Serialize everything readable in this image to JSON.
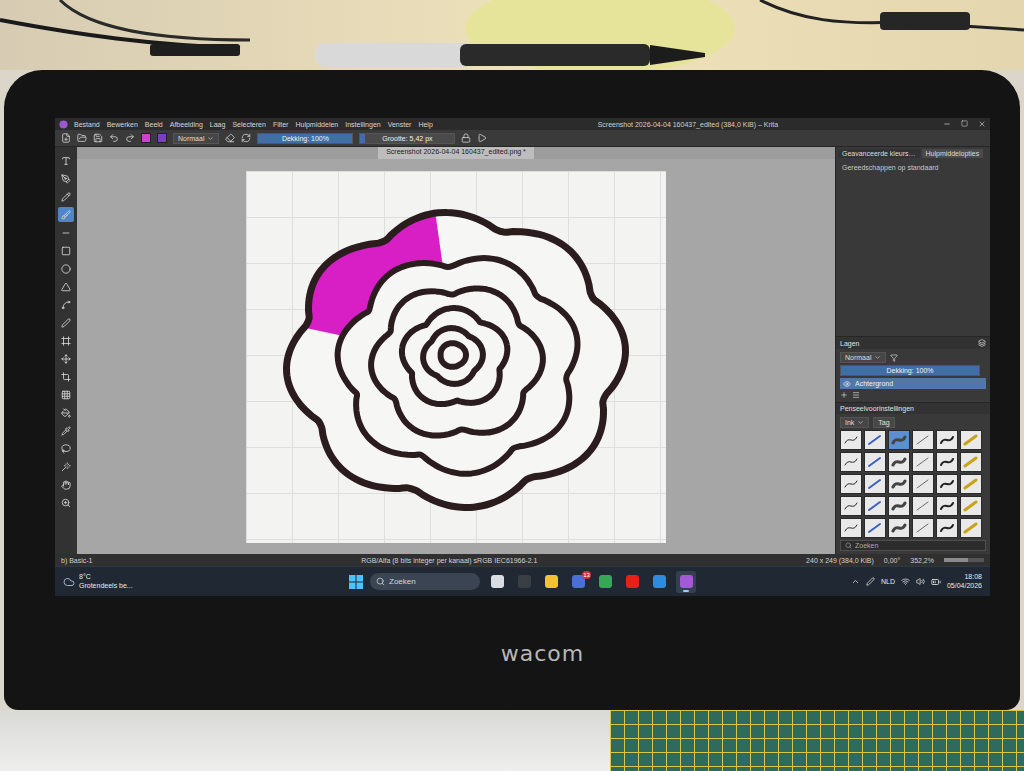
{
  "device": {
    "brand": "wacom"
  },
  "window": {
    "title": "Screenshot 2026-04-04 160437_edited (384,0 KiB) – Krita",
    "menu": [
      "Bestand",
      "Bewerken",
      "Beeld",
      "Afbeelding",
      "Laag",
      "Selecteren",
      "Filter",
      "Hulpmiddelen",
      "Instellingen",
      "Venster",
      "Help"
    ]
  },
  "toolbar": {
    "colors": [
      {
        "color": "#d43fc9"
      },
      {
        "color": "#7a3fc9"
      }
    ],
    "blend_mode": "Normaal",
    "opacity": "Dekking: 100%",
    "opacity_level": 1,
    "size": "Grootte: 5,42 px",
    "size_level": 0.05
  },
  "document_tab": {
    "label": "Screenshot 2026-04-04 160437_edited.png *",
    "selected": true
  },
  "tools": [
    {
      "selected": false
    },
    {
      "selected": false
    },
    {
      "selected": false
    },
    {
      "selected": true
    },
    {
      "selected": false
    },
    {
      "selected": false
    },
    {
      "selected": false
    },
    {
      "selected": false
    },
    {
      "selected": false
    },
    {
      "selected": false
    },
    {
      "selected": false
    },
    {
      "selected": false
    },
    {
      "selected": false
    },
    {
      "selected": false
    },
    {
      "selected": false
    },
    {
      "selected": false
    },
    {
      "selected": false
    },
    {
      "selected": false
    },
    {
      "selected": false
    },
    {
      "selected": false
    }
  ],
  "dock": {
    "tabs": [
      {
        "label": "Geavanceerde kleurs…",
        "selected": false
      },
      {
        "label": "Hulpmiddelopties",
        "selected": true
      }
    ],
    "hint": "Gereedschappen op standaard",
    "layers": {
      "title": "Lagen",
      "blend_mode": "Normaal",
      "opacity": "Dekking: 100%",
      "opacity_level": 1,
      "items": [
        {
          "name": "Achtergrond",
          "selected": true,
          "visible": true
        }
      ]
    },
    "brush_presets": {
      "title": "Penseelvoorinstellingen",
      "tag": "Ink",
      "tag_button": "Tag",
      "search": "Zoeken",
      "items": [
        {
          "selected": false
        },
        {
          "selected": false
        },
        {
          "selected": true
        },
        {
          "selected": false
        },
        {
          "selected": false
        },
        {
          "selected": false
        },
        {
          "selected": false
        },
        {
          "selected": false
        },
        {
          "selected": false
        },
        {
          "selected": false
        },
        {
          "selected": false
        },
        {
          "selected": false
        },
        {
          "selected": false
        },
        {
          "selected": false
        },
        {
          "selected": false
        },
        {
          "selected": false
        },
        {
          "selected": false
        },
        {
          "selected": false
        },
        {
          "selected": false
        },
        {
          "selected": false
        },
        {
          "selected": false
        },
        {
          "selected": false
        },
        {
          "selected": false
        },
        {
          "selected": false
        },
        {
          "selected": false
        },
        {
          "selected": false
        },
        {
          "selected": false
        },
        {
          "selected": false
        },
        {
          "selected": false
        },
        {
          "selected": false
        }
      ]
    }
  },
  "status_bar": {
    "preset": "b) Basic-1",
    "color_space": "RGB/Alfa (8 bits integer per kanaal)  sRGB IEC61966-2.1",
    "image_size": "240 x 249 (384,0 KiB)",
    "rotation": "0,00°",
    "zoom": "352,2%",
    "zoom_level": 0.6
  },
  "taskbar": {
    "weather_temp": "8°C",
    "weather_text": "Grotendeels be...",
    "search": "Zoeken",
    "apps": [
      {
        "color": "#d9dde3",
        "badge": "",
        "selected": false
      },
      {
        "color": "#3a3f46",
        "badge": "",
        "selected": false
      },
      {
        "color": "#f2c233",
        "badge": "",
        "selected": false
      },
      {
        "color": "#4b6fd8",
        "badge": "13",
        "selected": false
      },
      {
        "color": "#35a853",
        "badge": "",
        "selected": false
      },
      {
        "color": "#e62117",
        "badge": "",
        "selected": false
      },
      {
        "color": "#2b8ce0",
        "badge": "",
        "selected": false
      },
      {
        "color": "#a35ad6",
        "badge": "",
        "selected": true
      }
    ],
    "language": "NLD",
    "time": "18:08",
    "date": "05/04/2026"
  }
}
